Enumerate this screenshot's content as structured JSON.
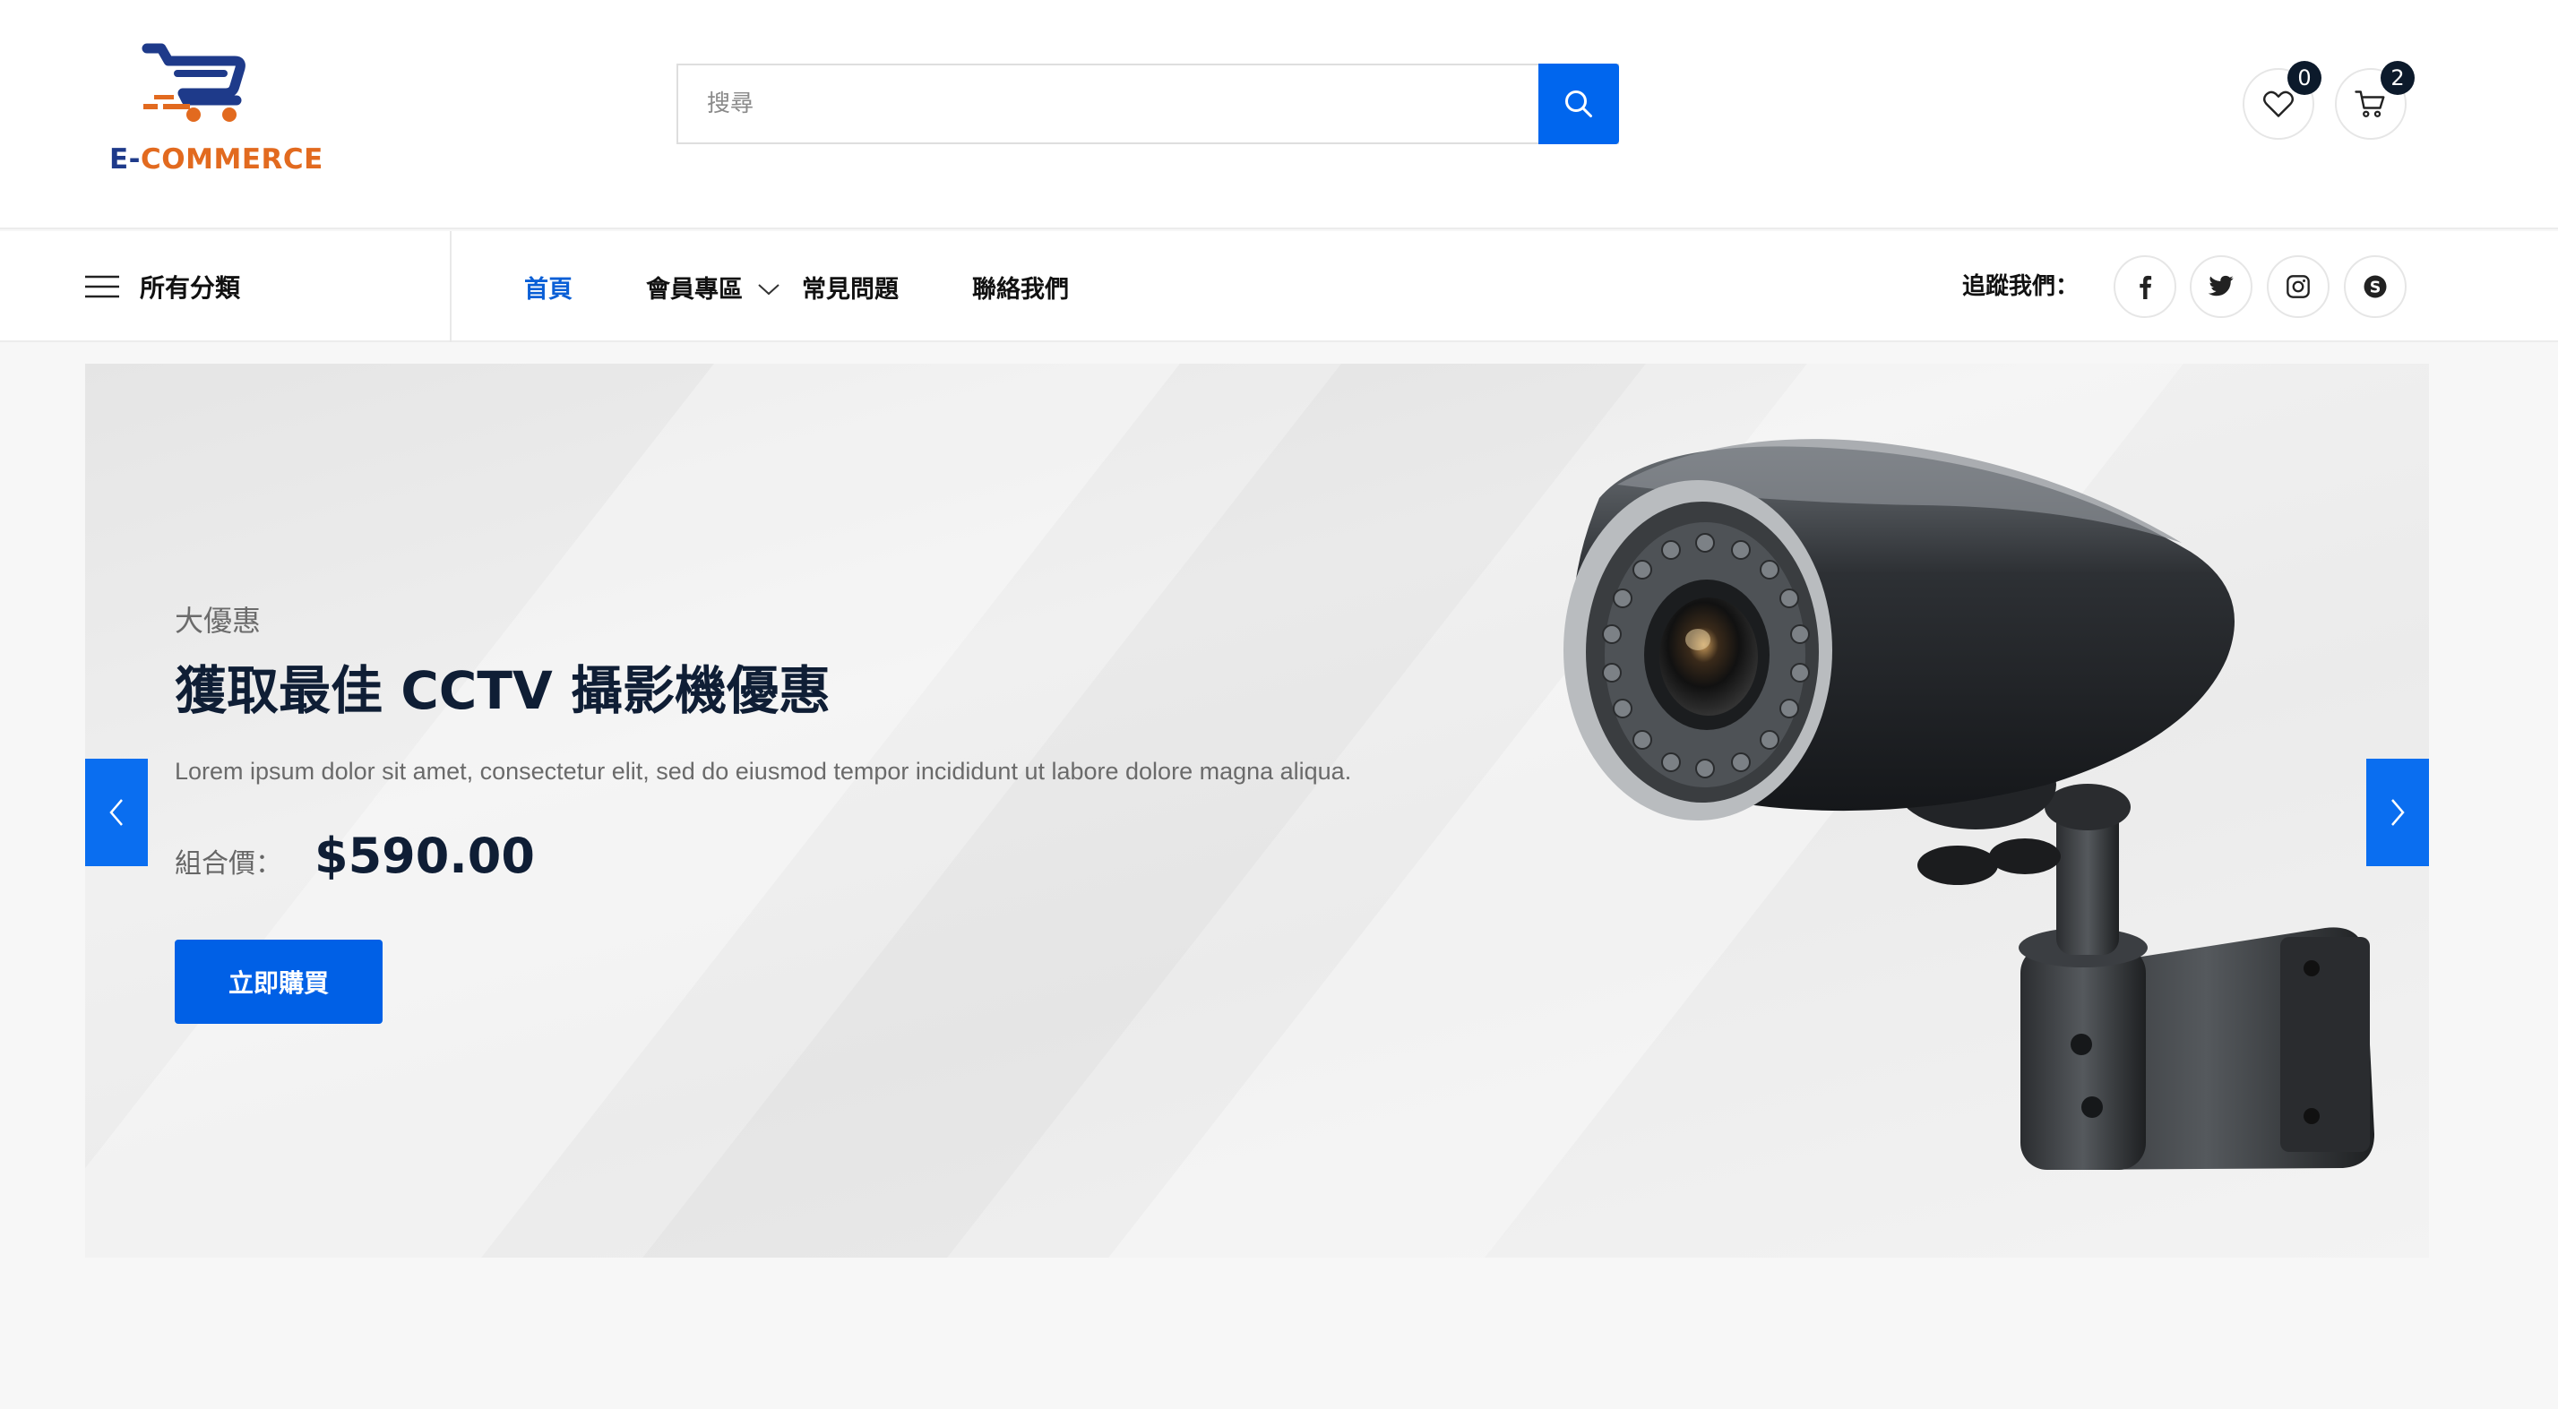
{
  "brand": {
    "part1": "E-",
    "part2": "COMMERCE",
    "color_primary": "#1e3a8a",
    "color_accent": "#e26a1f"
  },
  "search": {
    "placeholder": "搜尋",
    "value": ""
  },
  "header_icons": {
    "wishlist_count": "0",
    "cart_count": "2"
  },
  "nav": {
    "categories_label": "所有分類",
    "menu": [
      {
        "label": "首頁",
        "active": true
      },
      {
        "label": "會員專區",
        "has_dropdown": true
      },
      {
        "label": "常見問題"
      },
      {
        "label": "聯絡我們"
      }
    ],
    "follow_label": "追蹤我們：",
    "social": [
      "facebook-icon",
      "twitter-icon",
      "instagram-icon",
      "skype-icon"
    ]
  },
  "hero": {
    "subtitle": "大優惠",
    "title": "獲取最佳 CCTV 攝影機優惠",
    "description": "Lorem ipsum dolor sit amet, consectetur elit, sed do eiusmod tempor incididunt ut labore dolore magna aliqua.",
    "price_label": "組合價：",
    "price": "$590.00",
    "button": "立即購買"
  },
  "colors": {
    "accent_blue": "#0066ee",
    "dark_navy": "#0f1e35"
  }
}
